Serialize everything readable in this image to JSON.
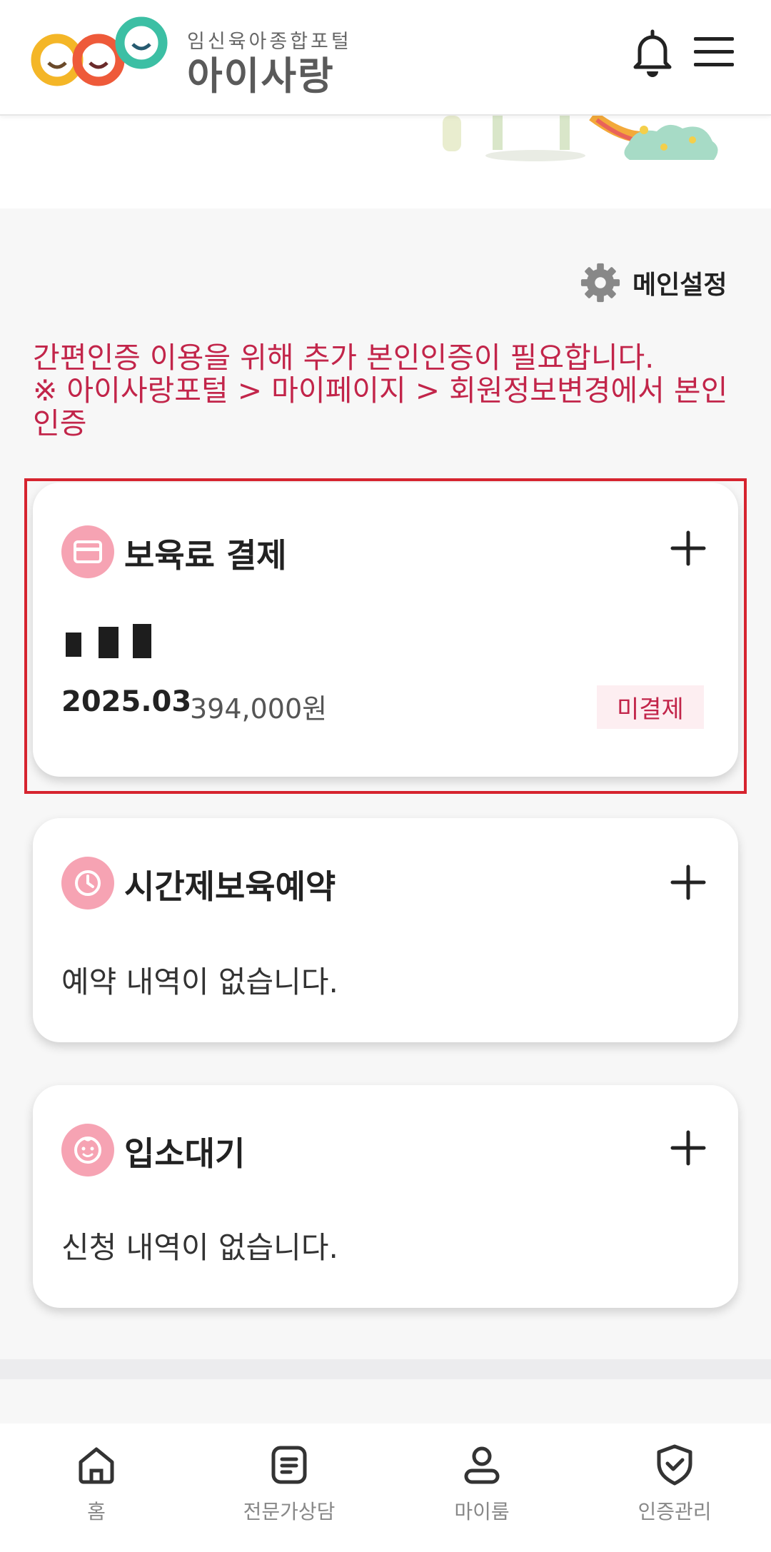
{
  "header": {
    "logo_tagline": "임신육아종합포털",
    "logo_name": "아이사랑",
    "icons": [
      "bell-icon",
      "hamburger-menu-icon"
    ]
  },
  "settings": {
    "label": "메인설정",
    "icon": "gear-icon"
  },
  "notice": {
    "line1": "간편인증 이용을 위해 추가 본인인증이 필요합니다.",
    "line2": "※ 아이사랑포털 > 마이페이지 > 회원정보변경에서 본인인증"
  },
  "cards": {
    "payment": {
      "title": "보육료 결제",
      "icon": "card-icon",
      "child_name": "이*아",
      "period": "2025.03",
      "amount": "394,000원",
      "status": "미결제"
    },
    "timecare": {
      "title": "시간제보육예약",
      "icon": "clock-icon",
      "empty_text": "예약 내역이 없습니다."
    },
    "admission": {
      "title": "입소대기",
      "icon": "baby-face-icon",
      "empty_text": "신청 내역이 없습니다."
    }
  },
  "nav": [
    {
      "label": "홈",
      "icon": "home-icon"
    },
    {
      "label": "전문가상담",
      "icon": "document-icon"
    },
    {
      "label": "마이룸",
      "icon": "person-icon"
    },
    {
      "label": "인증관리",
      "icon": "shield-check-icon"
    }
  ],
  "colors": {
    "accent_red": "#c2254a",
    "icon_pink": "#f6a3b3",
    "highlight_border": "#d6242f"
  }
}
